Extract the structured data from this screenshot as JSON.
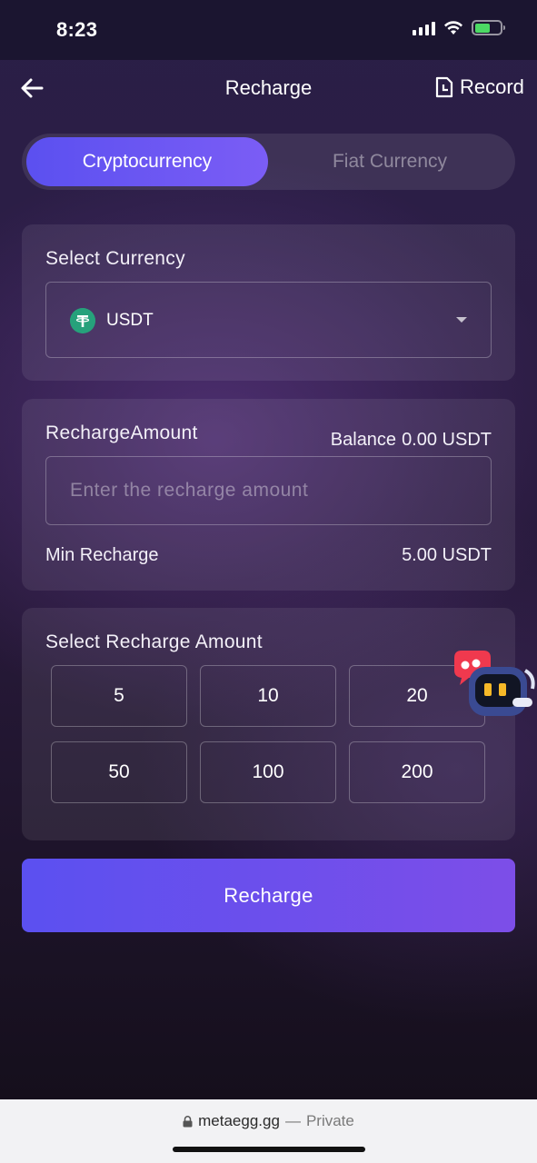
{
  "status_bar": {
    "time": "8:23"
  },
  "nav": {
    "title": "Recharge",
    "record_label": "Record"
  },
  "tabs": {
    "active": "Cryptocurrency",
    "inactive": "Fiat Currency"
  },
  "currency": {
    "label": "Select Currency",
    "selected": "USDT",
    "icon": "tether-icon"
  },
  "amount": {
    "label": "RechargeAmount",
    "balance_label": "Balance",
    "balance_value": "0.00 USDT",
    "placeholder": "Enter the recharge amount",
    "min_label": "Min Recharge",
    "min_value": "5.00 USDT"
  },
  "preset": {
    "label": "Select Recharge Amount",
    "options": [
      "5",
      "10",
      "20",
      "50",
      "100",
      "200"
    ]
  },
  "submit": {
    "label": "Recharge"
  },
  "browser": {
    "domain": "metaegg.gg",
    "separator": "—",
    "mode": "Private"
  },
  "colors": {
    "accent": "#5b50f0",
    "accent_end": "#7d4ee8",
    "tether": "#26a17b"
  }
}
